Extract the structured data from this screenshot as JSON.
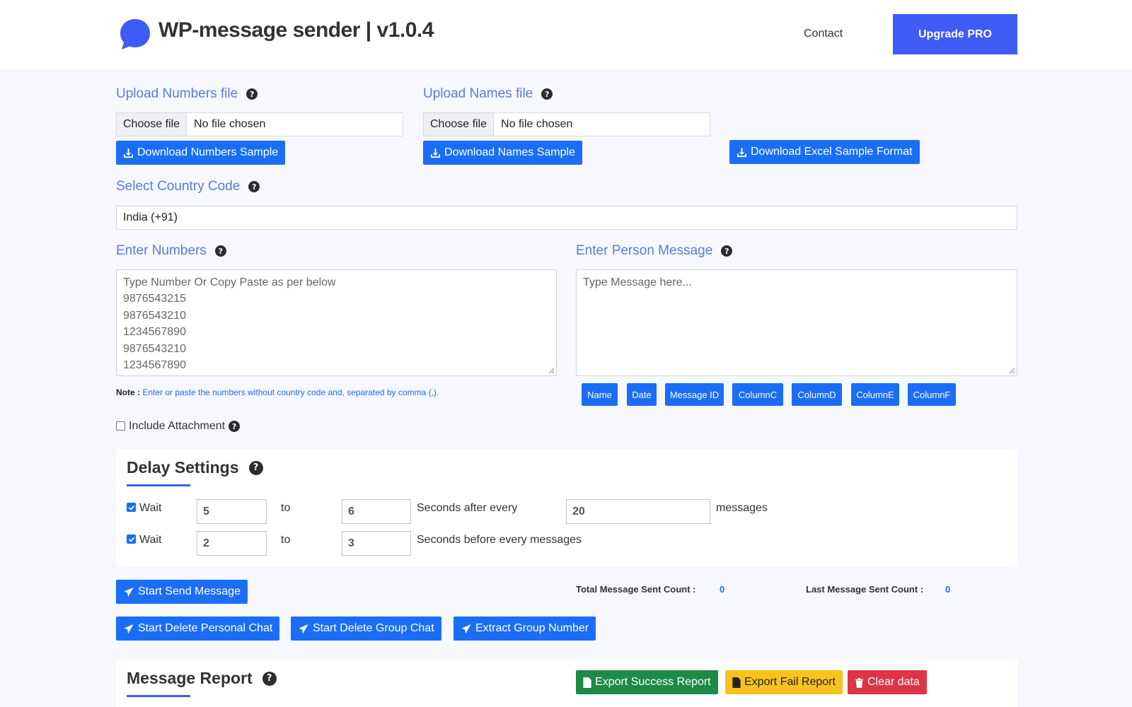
{
  "header": {
    "title": "WP-message sender | v1.0.4",
    "contact": "Contact",
    "upgrade": "Upgrade PRO"
  },
  "upload_numbers": {
    "label": "Upload Numbers file",
    "choose": "Choose file",
    "status": "No file chosen",
    "download": "Download Numbers Sample"
  },
  "upload_names": {
    "label": "Upload Names file",
    "choose": "Choose file",
    "status": "No file chosen",
    "download": "Download Names Sample"
  },
  "download_excel": "Download Excel Sample Format",
  "country": {
    "label": "Select Country Code",
    "selected": "India (+91)"
  },
  "numbers": {
    "label": "Enter Numbers",
    "placeholder_lines": [
      "Type Number Or Copy Paste as per below",
      "9876543215",
      "9876543210",
      "1234567890",
      "9876543210",
      "1234567890"
    ],
    "note_prefix": "Note :",
    "note_text": "Enter or paste the numbers without country code and, separated by comma (,)."
  },
  "message": {
    "label": "Enter Person Message",
    "placeholder": "Type Message here..."
  },
  "variables": [
    "Name",
    "Date",
    "Message ID",
    "ColumnC",
    "ColumnD",
    "ColumnE",
    "ColumnF"
  ],
  "attachment": {
    "label": "Include Attachment",
    "checked": false
  },
  "delay": {
    "title": "Delay Settings",
    "row1": {
      "checked": true,
      "wait": "Wait",
      "from": "5",
      "to_label": "to",
      "to": "6",
      "suffix": "Seconds after every",
      "count": "20",
      "unit": "messages"
    },
    "row2": {
      "checked": true,
      "wait": "Wait",
      "from": "2",
      "to_label": "to",
      "to": "3",
      "suffix": "Seconds before every messages"
    }
  },
  "actions": {
    "start_send": "Start Send Message",
    "delete_personal": "Start Delete Personal Chat",
    "delete_group": "Start Delete Group Chat",
    "extract_group": "Extract Group Number"
  },
  "counts": {
    "total_label": "Total Message Sent Count :",
    "total_value": "0",
    "last_label": "Last Message Sent Count :",
    "last_value": "0"
  },
  "report": {
    "title": "Message Report",
    "export_success": "Export Success Report",
    "export_fail": "Export Fail Report",
    "clear": "Clear data"
  },
  "colors": {
    "primary": "#1a6ef5",
    "accent": "#3e5cf5",
    "label": "#5b7bd6",
    "success": "#1d8a47",
    "warning": "#f8c21c",
    "danger": "#dc3545"
  },
  "icons": {
    "logo": "chat-bubble-icon",
    "help": "question-circle-icon",
    "download": "download-icon",
    "send": "paper-plane-icon",
    "file": "file-icon",
    "trash": "trash-icon"
  }
}
